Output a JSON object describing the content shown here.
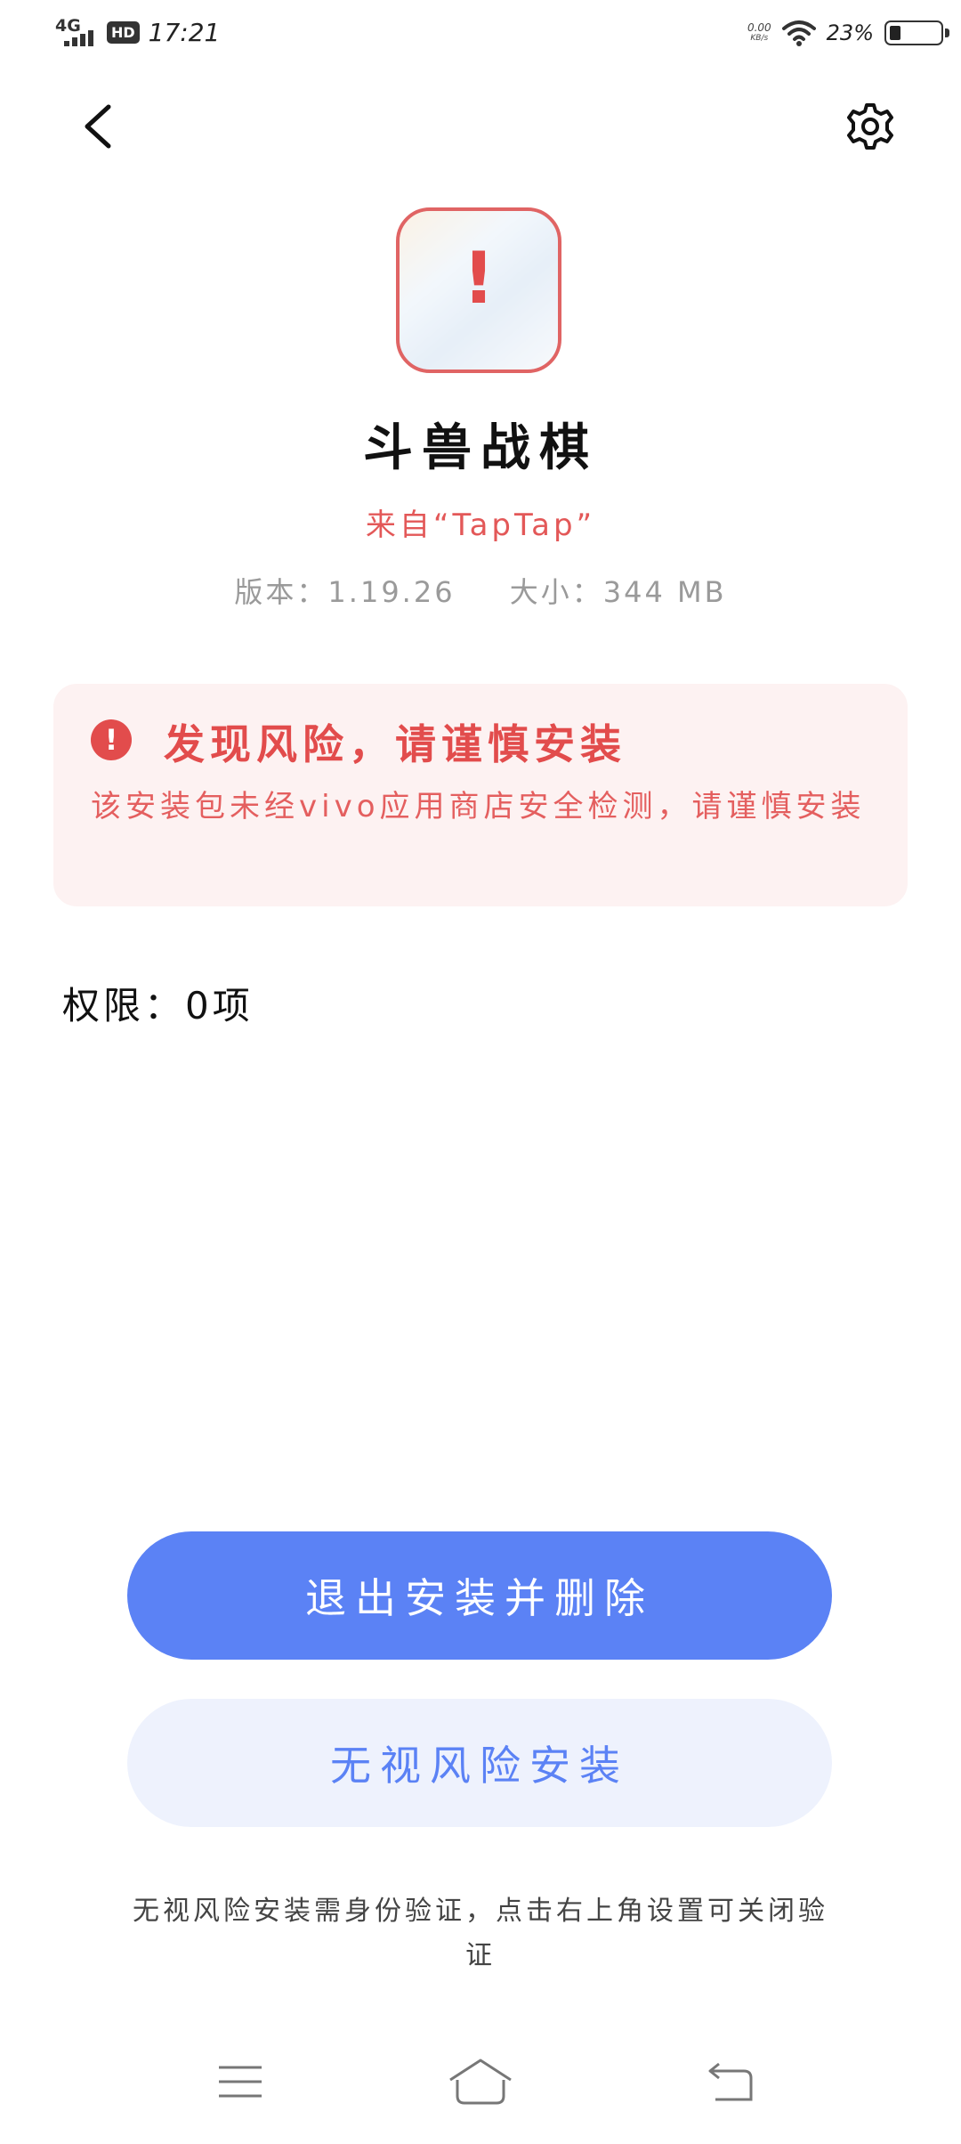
{
  "status_bar": {
    "network": "4G",
    "hd": "HD",
    "time": "17:21",
    "net_speed_value": "0.00",
    "net_speed_unit": "KB/s",
    "battery_percent_text": "23%",
    "battery_level": 0.23
  },
  "header": {
    "back_icon": "chevron-left-icon",
    "settings_icon": "gear-icon"
  },
  "app": {
    "name": "斗兽战棋",
    "source": "来自“TapTap”",
    "version": "版本：1.19.26",
    "size": "大小：344 MB"
  },
  "warning": {
    "title": "发现风险，请谨慎安装",
    "body": "该安装包未经vivo应用商店安全检测，请谨慎安装"
  },
  "permissions": {
    "text": "权限：0项"
  },
  "buttons": {
    "exit_delete": "退出安装并删除",
    "ignore_install": "无视风险安装"
  },
  "hint": "无视风险安装需身份验证，点击右上角设置可关闭验证",
  "colors": {
    "primary": "#5b82f5",
    "danger": "#e24c4c",
    "warning_bg": "#fdf2f2",
    "secondary_bg": "#eef2fd"
  }
}
